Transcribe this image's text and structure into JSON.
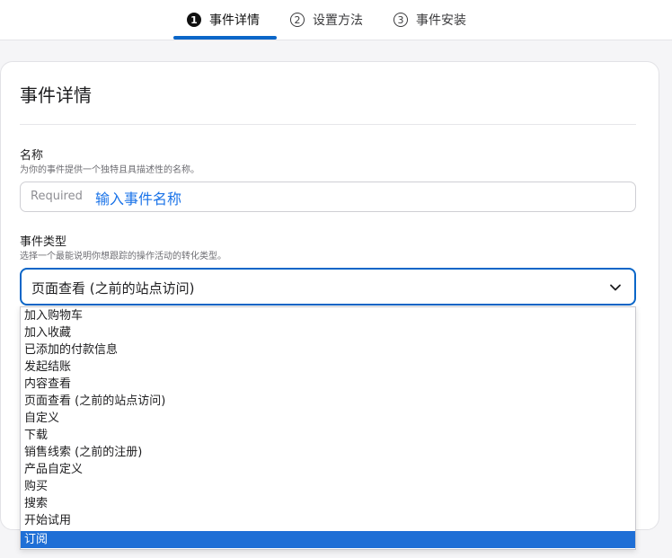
{
  "stepper": {
    "steps": [
      {
        "num": "1",
        "label": "事件详情"
      },
      {
        "num": "2",
        "label": "设置方法"
      },
      {
        "num": "3",
        "label": "事件安装"
      }
    ]
  },
  "card": {
    "title": "事件详情",
    "name_field": {
      "label": "名称",
      "help": "为你的事件提供一个独特且具描述性的名称。",
      "placeholder": "Required",
      "annotation": "输入事件名称"
    },
    "type_field": {
      "label": "事件类型",
      "help": "选择一个最能说明你想跟踪的操作活动的转化类型。",
      "selected": "页面查看 (之前的站点访问)",
      "options": [
        "加入购物车",
        "加入收藏",
        "已添加的付款信息",
        "发起结账",
        "内容查看",
        "页面查看 (之前的站点访问)",
        "自定义",
        "下载",
        "销售线索 (之前的注册)",
        "产品自定义",
        "购买",
        "搜索",
        "开始试用",
        "订阅"
      ],
      "highlighted": "订阅"
    }
  },
  "colors": {
    "accent": "#0a66c8",
    "highlight": "#1f6fd6",
    "annotation": "#1a73e8"
  }
}
